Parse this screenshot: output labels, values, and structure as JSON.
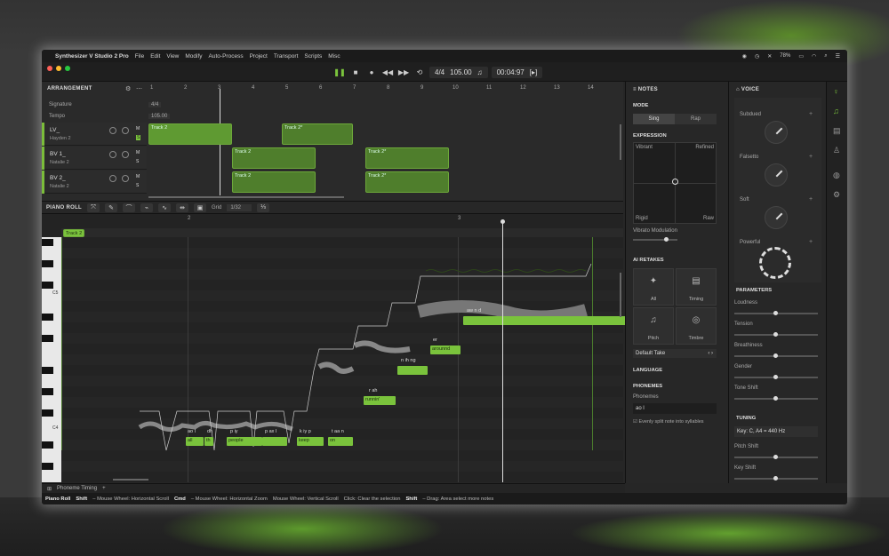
{
  "menubar": {
    "app": "Synthesizer V Studio 2 Pro",
    "items": [
      "File",
      "Edit",
      "View",
      "Modify",
      "Auto-Process",
      "Project",
      "Transport",
      "Scripts",
      "Misc"
    ],
    "battery": "78%",
    "right_icons": [
      "record-icon",
      "clock-icon",
      "tools-icon",
      "wifi-icon",
      "battery-icon",
      "search-icon",
      "control-icon"
    ]
  },
  "toolbar": {
    "time_sig": "4/4",
    "tempo": "105.00",
    "time": "00:04:97"
  },
  "arrangement": {
    "title": "ARRANGEMENT",
    "signature_label": "Signature",
    "signature_value": "4/4",
    "tempo_label": "Tempo",
    "tempo_value": "105.00",
    "ruler": [
      "1",
      "2",
      "3",
      "4",
      "5",
      "6",
      "7",
      "8",
      "9",
      "10",
      "11",
      "12",
      "13",
      "14"
    ],
    "tracks": [
      {
        "name": "LV_",
        "singer": "Hayden 2"
      },
      {
        "name": "BV 1_",
        "singer": "Natalie 2"
      },
      {
        "name": "BV 2_",
        "singer": "Natalie 2"
      }
    ],
    "clips": [
      "Track 2",
      "Track 2*",
      "Track 2",
      "Track 2*",
      "Track 2",
      "Track 2*"
    ]
  },
  "pianoroll": {
    "title": "PIANO ROLL",
    "grid_label": "Grid",
    "grid_value": "1/32",
    "clip_label": "Track 2",
    "bar2": "2",
    "bar3": "3",
    "c5": "C5",
    "c4": "C4",
    "notes": [
      {
        "ph": "ao l",
        "lyric": "all"
      },
      {
        "ph": "dh",
        "lyric": "th"
      },
      {
        "ph": "p iy",
        "lyric": "people"
      },
      {
        "ph": "p ax l",
        "lyric": ""
      },
      {
        "ph": "k iy p",
        "lyric": "keep"
      },
      {
        "ph": "t aa n",
        "lyric": "on"
      },
      {
        "ph": "r ah",
        "lyric": "runnin'"
      },
      {
        "ph": "n ih ng",
        "lyric": ""
      },
      {
        "ph": "er",
        "lyric": "arounnd"
      },
      {
        "ph": "aw n d",
        "lyric": ""
      }
    ]
  },
  "notes_panel": {
    "title": "NOTES",
    "mode": "MODE",
    "sing": "Sing",
    "rap": "Rap",
    "expression": "EXPRESSION",
    "vibrant": "Vibrant",
    "refined": "Refined",
    "rigid": "Rigid",
    "raw": "Raw",
    "vibrato_mod": "Vibrato Modulation",
    "vibrato_value": 0.7,
    "ai_retakes": "AI RETAKES",
    "all": "All",
    "timing": "Timing",
    "pitch": "Pitch",
    "timbre": "Timbre",
    "default_take": "Default Take",
    "language": "LANGUAGE",
    "phonemes_title": "PHONEMES",
    "phonemes_label": "Phonemes",
    "phonemes_value": "ao l",
    "split": "Evenly split note into syllables"
  },
  "voice_panel": {
    "title": "VOICE",
    "subdued": "Subdued",
    "falsetto": "Falsetto",
    "soft": "Soft",
    "powerful": "Powerful",
    "parameters": "PARAMETERS",
    "loudness": "Loudness",
    "tension": "Tension",
    "breathiness": "Breathiness",
    "gender": "Gender",
    "tone_shift": "Tone Shift",
    "tuning": "TUNING",
    "key": "Key: C, A4 = 440 Hz",
    "pitch_shift": "Pitch Shift",
    "key_shift": "Key Shift"
  },
  "bottom": {
    "tab": "Phoneme Timing",
    "add": "+"
  },
  "status": {
    "mode": "Piano Roll",
    "k1": "Shift",
    "d1": "– Mouse Wheel: Horizontal Scroll",
    "k2": "Cmd",
    "d2": "– Mouse Wheel: Horizontal Zoom",
    "d3": "Mouse Wheel: Vertical Scroll",
    "d4": "Click: Clear the selection",
    "k5": "Shift",
    "d5": "– Drag: Area select more notes"
  },
  "colors": {
    "accent": "#7ac33c",
    "clip": "#4f7e2c"
  }
}
